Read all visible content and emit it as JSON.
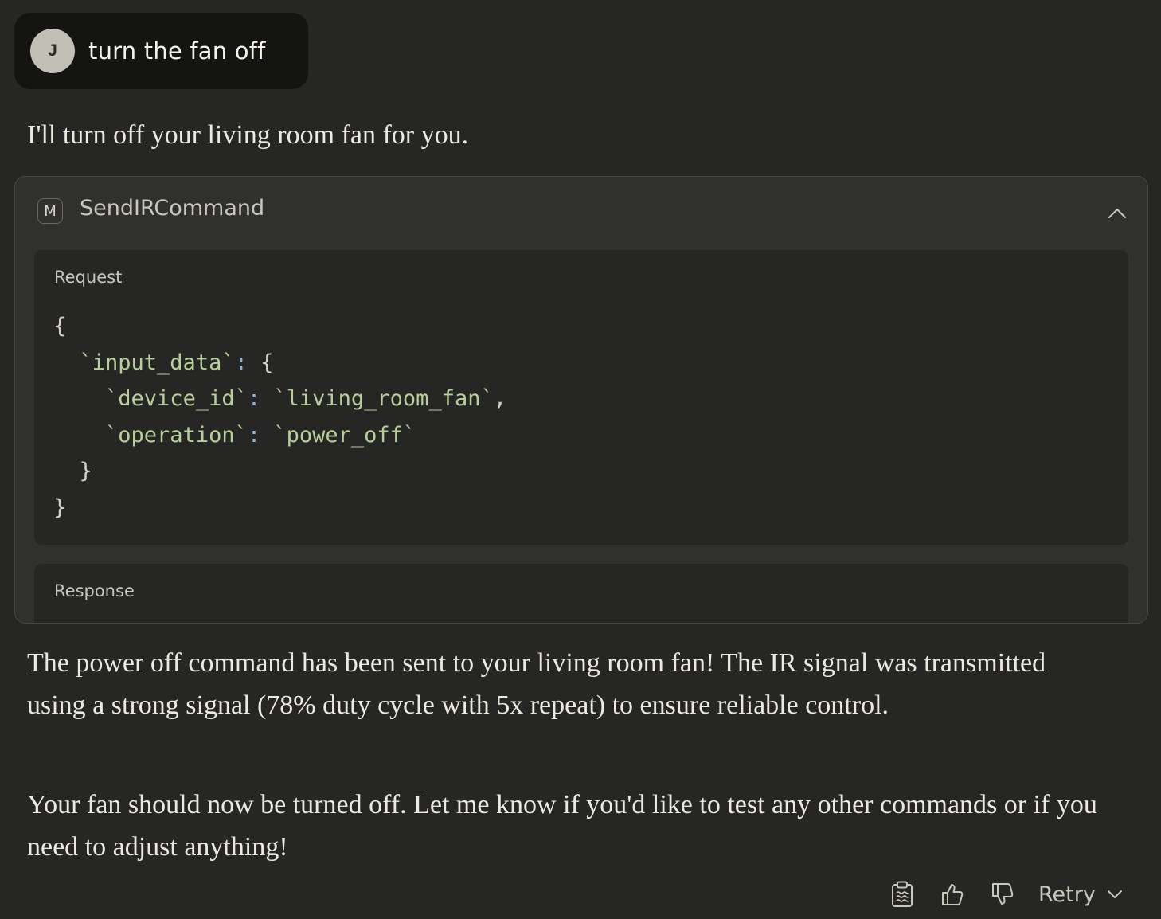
{
  "user_message": {
    "avatar_initial": "J",
    "text": "turn the fan off"
  },
  "assistant": {
    "intro": "I'll turn off your living room fan for you.",
    "tool_call": {
      "badge": "M",
      "name": "SendIRCommand",
      "request_label": "Request",
      "response_label": "Response",
      "request": {
        "line1": "{",
        "key_input_data": "`input_data`",
        "colon": ":",
        "open_brace": "{",
        "key_device_id": "`device_id`",
        "val_device_id": "`living_room_fan`",
        "comma": ",",
        "key_operation": "`operation`",
        "val_operation": "`power_off`",
        "close_inner": "}",
        "close_outer": "}"
      }
    },
    "paragraph1": "The power off command has been sent to your living room fan! The IR signal was transmitted using a strong signal (78% duty cycle with 5x repeat) to ensure reliable control.",
    "paragraph2": "Your fan should now be turned off. Let me know if you'd like to test any other commands or if you need to adjust anything!"
  },
  "actions": {
    "copy_icon": "clipboard-icon",
    "thumbs_up_icon": "thumbs-up-icon",
    "thumbs_down_icon": "thumbs-down-icon",
    "retry_label": "Retry",
    "retry_icon": "chevron-down-icon"
  },
  "colors": {
    "background": "#262624",
    "user_bubble": "#141413",
    "card": "#30302e",
    "code_string": "#b7cf9a",
    "code_colon": "#89b4e0"
  }
}
